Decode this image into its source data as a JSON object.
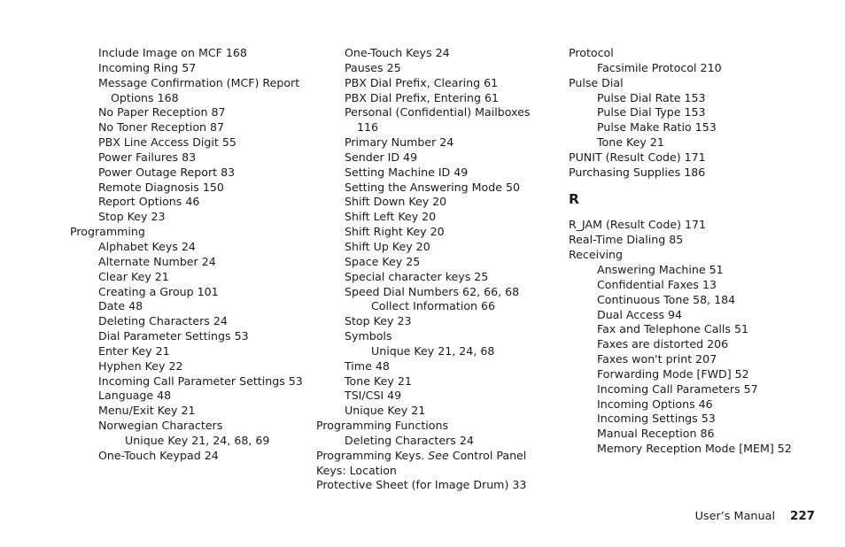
{
  "document": {
    "type": "index-page",
    "footer": {
      "manual_label": "User’s Manual",
      "page_number": "227"
    }
  },
  "columns": [
    {
      "name": "column-1",
      "entries": [
        {
          "level": 1,
          "text": "Include Image on MCF  168"
        },
        {
          "level": 1,
          "text": "Incoming Ring  57"
        },
        {
          "level": 1,
          "text": "Message Confirmation (MCF) Report Options  168"
        },
        {
          "level": 1,
          "text": "No Paper Reception  87"
        },
        {
          "level": 1,
          "text": "No Toner Reception  87"
        },
        {
          "level": 1,
          "text": "PBX Line Access Digit  55"
        },
        {
          "level": 1,
          "text": "Power Failures  83"
        },
        {
          "level": 1,
          "text": "Power Outage Report  83"
        },
        {
          "level": 1,
          "text": "Remote Diagnosis  150"
        },
        {
          "level": 1,
          "text": "Report Options  46"
        },
        {
          "level": 1,
          "text": "Stop Key  23"
        },
        {
          "level": 0,
          "text": "Programming"
        },
        {
          "level": 1,
          "text": "Alphabet Keys  24"
        },
        {
          "level": 1,
          "text": "Alternate Number  24"
        },
        {
          "level": 1,
          "text": "Clear Key  21"
        },
        {
          "level": 1,
          "text": "Creating a Group  101"
        },
        {
          "level": 1,
          "text": "Date  48"
        },
        {
          "level": 1,
          "text": "Deleting Characters  24"
        },
        {
          "level": 1,
          "text": "Dial Parameter Settings  53"
        },
        {
          "level": 1,
          "text": "Enter Key  21"
        },
        {
          "level": 1,
          "text": "Hyphen Key  22"
        },
        {
          "level": 1,
          "text": "Incoming Call Parameter Settings  53"
        },
        {
          "level": 1,
          "text": "Language  48"
        },
        {
          "level": 1,
          "text": "Menu/Exit Key  21"
        },
        {
          "level": 1,
          "text": "Norwegian Characters"
        },
        {
          "level": 2,
          "text": "Unique Key  21, 24, 68, 69"
        },
        {
          "level": 1,
          "text": "One-Touch Keypad  24"
        }
      ]
    },
    {
      "name": "column-2",
      "entries": [
        {
          "level": 1,
          "text": "One-Touch Keys  24"
        },
        {
          "level": 1,
          "text": "Pauses  25"
        },
        {
          "level": 1,
          "text": "PBX Dial Prefix, Clearing  61"
        },
        {
          "level": 1,
          "text": "PBX Dial Prefix, Entering  61"
        },
        {
          "level": 1,
          "text": "Personal (Confidential) Mailboxes  116"
        },
        {
          "level": 1,
          "text": "Primary Number  24"
        },
        {
          "level": 1,
          "text": "Sender ID  49"
        },
        {
          "level": 1,
          "text": "Setting Machine ID  49"
        },
        {
          "level": 1,
          "text": "Setting the Answering Mode  50"
        },
        {
          "level": 1,
          "text": "Shift Down Key  20"
        },
        {
          "level": 1,
          "text": "Shift Left Key  20"
        },
        {
          "level": 1,
          "text": "Shift Right Key  20"
        },
        {
          "level": 1,
          "text": "Shift Up Key  20"
        },
        {
          "level": 1,
          "text": "Space Key  25"
        },
        {
          "level": 1,
          "text": "Special character keys  25"
        },
        {
          "level": 1,
          "text": "Speed Dial Numbers  62, 66, 68"
        },
        {
          "level": 2,
          "text": "Collect Information  66"
        },
        {
          "level": 1,
          "text": "Stop Key  23"
        },
        {
          "level": 1,
          "text": "Symbols"
        },
        {
          "level": 2,
          "text": "Unique Key  21, 24, 68"
        },
        {
          "level": 1,
          "text": "Time  48"
        },
        {
          "level": 1,
          "text": "Tone Key  21"
        },
        {
          "level": 1,
          "text": "TSI/CSI  49"
        },
        {
          "level": 1,
          "text": "Unique Key  21"
        },
        {
          "level": 0,
          "text": "Programming Functions"
        },
        {
          "level": 1,
          "text": "Deleting Characters  24"
        },
        {
          "level": 0,
          "text": "Programming Keys. ",
          "italic": "See",
          "text_after": " Control Panel Keys: Location"
        },
        {
          "level": 0,
          "text": "Protective Sheet (for Image Drum)  33"
        }
      ]
    },
    {
      "name": "column-3",
      "entries": [
        {
          "level": 0,
          "text": "Protocol"
        },
        {
          "level": 1,
          "text": "Facsimile Protocol  210"
        },
        {
          "level": 0,
          "text": "Pulse Dial"
        },
        {
          "level": 1,
          "text": "Pulse Dial Rate  153"
        },
        {
          "level": 1,
          "text": "Pulse Dial Type  153"
        },
        {
          "level": 1,
          "text": "Pulse Make Ratio  153"
        },
        {
          "level": 1,
          "text": "Tone Key  21"
        },
        {
          "level": 0,
          "text": "PUNIT (Result Code)  171"
        },
        {
          "level": 0,
          "text": "Purchasing Supplies  186"
        },
        {
          "heading": "R"
        },
        {
          "level": 0,
          "text": "R_JAM (Result Code)  171"
        },
        {
          "level": 0,
          "text": "Real-Time Dialing  85"
        },
        {
          "level": 0,
          "text": "Receiving"
        },
        {
          "level": 1,
          "text": "Answering Machine  51"
        },
        {
          "level": 1,
          "text": "Confidential Faxes  13"
        },
        {
          "level": 1,
          "text": "Continuous Tone  58, 184"
        },
        {
          "level": 1,
          "text": "Dual Access  94"
        },
        {
          "level": 1,
          "text": "Fax and Telephone Calls  51"
        },
        {
          "level": 1,
          "text": "Faxes are distorted  206"
        },
        {
          "level": 1,
          "text": "Faxes won't print  207"
        },
        {
          "level": 1,
          "text": "Forwarding Mode [FWD]  52"
        },
        {
          "level": 1,
          "text": "Incoming Call Parameters  57"
        },
        {
          "level": 1,
          "text": "Incoming Options  46"
        },
        {
          "level": 1,
          "text": "Incoming Settings  53"
        },
        {
          "level": 1,
          "text": "Manual Reception  86"
        },
        {
          "level": 1,
          "text": "Memory Reception Mode [MEM]  52"
        }
      ]
    }
  ]
}
